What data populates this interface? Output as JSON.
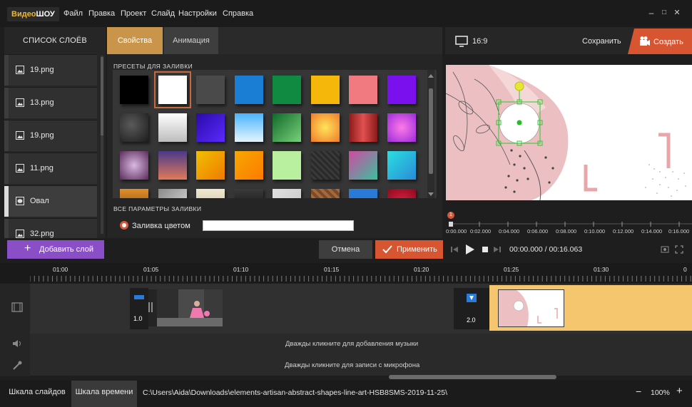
{
  "app": {
    "logo_part1": "Видео",
    "logo_part2": "ШОУ"
  },
  "menu": [
    "Файл",
    "Правка",
    "Проект",
    "Слайд",
    "Настройки",
    "Справка"
  ],
  "window_controls": {
    "minimize": "–",
    "maximize": "□",
    "close": "✕"
  },
  "layers": {
    "title": "СПИСОК СЛОЁВ",
    "items": [
      {
        "label": "19.png",
        "type": "image"
      },
      {
        "label": "13.png",
        "type": "image"
      },
      {
        "label": "19.png",
        "type": "image"
      },
      {
        "label": "11.png",
        "type": "image"
      },
      {
        "label": "Овал",
        "type": "shape",
        "selected": true
      },
      {
        "label": "32.png",
        "type": "image"
      }
    ],
    "add_button": "Добавить слой"
  },
  "props": {
    "tabs": [
      "Свойства",
      "Анимация"
    ],
    "presets_title": "ПРЕСЕТЫ ДЛЯ ЗАЛИВКИ",
    "all_params_title": "ВСЕ ПАРАМЕТРЫ ЗАЛИВКИ",
    "fill_color_label": "Заливка цветом",
    "fill_color_value": "",
    "selected_swatch": 1,
    "swatches": [
      "#000000",
      "#ffffff",
      "#4a4a4a",
      "#1a7fd4",
      "#0f8a40",
      "#f5b80a",
      "#f07a80",
      "#7a10ee",
      "radial-gradient(circle at 40% 40%,#5a5a5a,#1c1c1c)",
      "linear-gradient(#ffffff,#bdbdbd)",
      "linear-gradient(135deg,#2a0aa8,#5a2aff)",
      "linear-gradient(#48b4ff,#e6f4ff)",
      "linear-gradient(135deg,#0e6a2a,#7ad07a)",
      "radial-gradient(circle,#ffe45a,#f07a2a)",
      "linear-gradient(90deg,#8a1a1a,#e05050,#8a1a1a)",
      "radial-gradient(circle,#ff7ae8,#9a2ad8)",
      "radial-gradient(circle,#d8b8e0,#5a2a5a)",
      "linear-gradient(#4a3a8a,#e07a5a)",
      "linear-gradient(135deg,#f0c000,#f07a00)",
      "linear-gradient(135deg,#f5a800,#ff7a00)",
      "#b8f0a0",
      "repeating-linear-gradient(45deg,#2a2a2a 0 3px,#3a3a3a 3px 6px)",
      "linear-gradient(135deg,#d04aa0,#3ac0a0)",
      "linear-gradient(135deg,#2ae0e0,#2a8ad8)",
      "linear-gradient(#e0902a,#7a3a0a)",
      "linear-gradient(135deg,#8a8a8a,#e0e0e0)",
      "linear-gradient(#f0e8d0,#c8b8a0)",
      "linear-gradient(#3a3a3a,#0a0a0a)",
      "linear-gradient(135deg,#e0e0e0,#c8c8c8)",
      "repeating-linear-gradient(45deg,#7a4a2a 0 4px,#a06a3a 4px 8px)",
      "#2a7ad8",
      "radial-gradient(circle,#e02040,#8a0a20)"
    ]
  },
  "preview": {
    "ratio": "16:9",
    "save": "Сохранить",
    "create": "Создать",
    "marker": "1",
    "ruler_ticks": [
      "0:00.000",
      "0:02.000",
      "0:04.000",
      "0:06.000",
      "0:08.000",
      "0:10.000",
      "0:12.000",
      "0:14.000",
      "0:16.000"
    ],
    "time_current": "00:00.000",
    "time_total": "00:16.063",
    "time_sep": " / "
  },
  "buttons": {
    "cancel": "Отмена",
    "apply": "Применить"
  },
  "timeline": {
    "ticks": [
      "01:00",
      "01:05",
      "01:10",
      "01:15",
      "01:20",
      "01:25",
      "01:30",
      "0"
    ],
    "transition1": "1.0",
    "transition2": "2.0",
    "music_hint": "Дважды кликните для добавления музыки",
    "mic_hint": "Дважды кликните для записи с микрофона"
  },
  "status": {
    "tab_slides": "Шкала слайдов",
    "tab_timeline": "Шкала времени",
    "path": "C:\\Users\\Aida\\Downloads\\elements-artisan-abstract-shapes-line-art-HSB8SMS-2019-11-25\\",
    "zoom": "100%",
    "zoom_minus": "−",
    "zoom_plus": "+"
  },
  "colors": {
    "accent": "#d85532",
    "tab_active": "#c8954b",
    "add_layer": "#8a4fc6",
    "clip_highlight": "#f6c66e"
  }
}
